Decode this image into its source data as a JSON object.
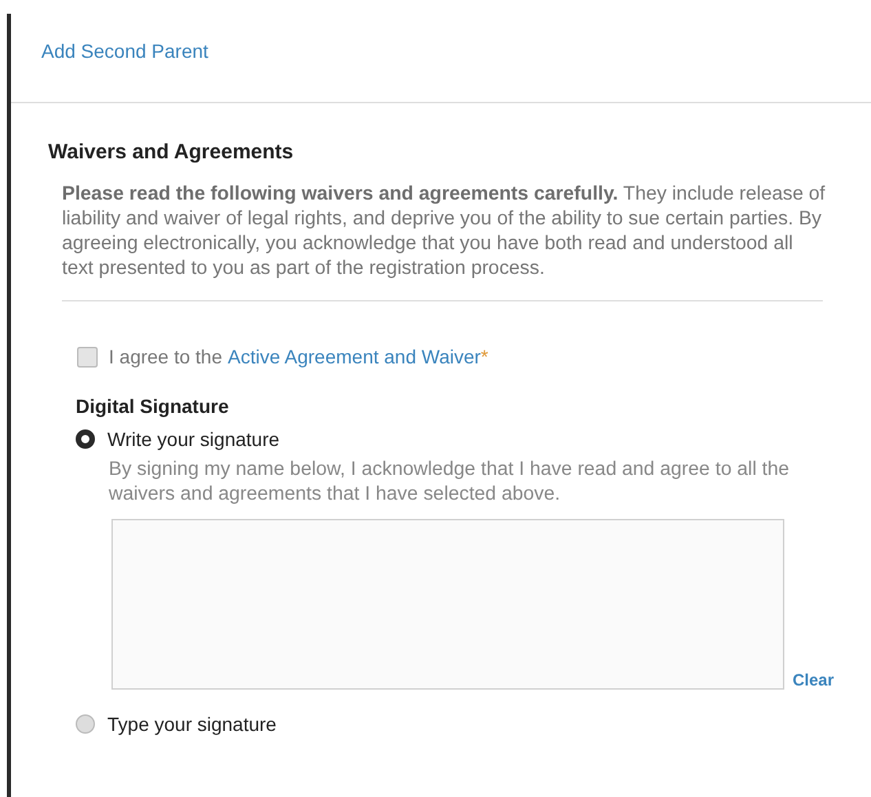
{
  "add_parent_link": "Add Second Parent",
  "waivers": {
    "title": "Waivers and Agreements",
    "intro": "**Please read the following waivers and agreements carefully.** They include release of liability and waiver of legal rights, and deprive you of the ability to sue certain parties. By agreeing electronically, you acknowledge that you have both read and understood all text presented to you as part of the registration process.",
    "agreements": [
      {
        "prefix": "I agree to the",
        "link": "Active Agreement and Waiver",
        "required_mark": "*",
        "checked": false
      }
    ]
  },
  "signature": {
    "title": "Digital Signature",
    "options": [
      {
        "label": "Write your signature",
        "selected": true,
        "description": "By signing my name below, I acknowledge that I have read and agree to all the waivers and agreements that I have selected above.",
        "clear_label": "Clear"
      },
      {
        "label": "Type your signature",
        "selected": false
      }
    ]
  }
}
